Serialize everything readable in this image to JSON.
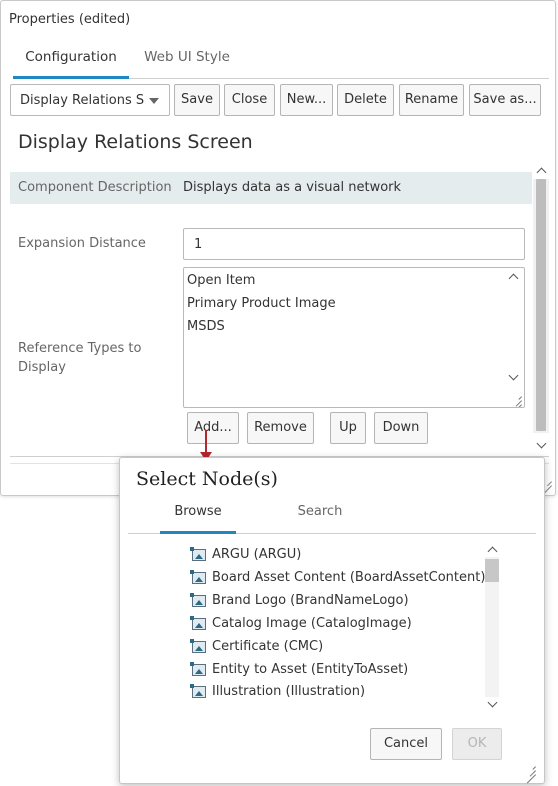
{
  "panel": {
    "title": "Properties (edited)",
    "tabs": [
      {
        "label": "Configuration",
        "active": true
      },
      {
        "label": "Web UI Style",
        "active": false
      }
    ],
    "toolbar": {
      "selected_screen": "Display Relations Screen",
      "buttons": [
        "Save",
        "Close",
        "New...",
        "Delete",
        "Rename",
        "Save as..."
      ]
    },
    "screen_title": "Display Relations Screen",
    "fields": {
      "component_description_label": "Component Description",
      "component_description_value": "Displays data as a visual network",
      "expansion_distance_label": "Expansion Distance",
      "expansion_distance_value": "1",
      "reference_types_label": "Reference Types to Display",
      "reference_types": [
        "Open Item",
        "Primary Product Image",
        "MSDS"
      ]
    },
    "list_buttons": [
      "Add...",
      "Remove",
      "Up",
      "Down"
    ]
  },
  "dialog": {
    "title": "Select Node(s)",
    "tabs": [
      {
        "label": "Browse",
        "active": true
      },
      {
        "label": "Search",
        "active": false
      }
    ],
    "nodes": [
      "ARGU (ARGU)",
      "Board Asset Content (BoardAssetContent)",
      "Brand Logo (BrandNameLogo)",
      "Catalog Image (CatalogImage)",
      "Certificate (CMC)",
      "Entity to Asset (EntityToAsset)",
      "Illustration (Illustration)"
    ],
    "buttons": {
      "cancel": "Cancel",
      "ok": "OK"
    }
  },
  "colors": {
    "accent": "#1f87c1",
    "row_highlight": "#e5ecee",
    "arrow": "#b3272d"
  },
  "icons": [
    "caret-down-icon",
    "chevron-up-icon",
    "chevron-down-icon",
    "resize-grip-icon",
    "node-image-icon"
  ]
}
